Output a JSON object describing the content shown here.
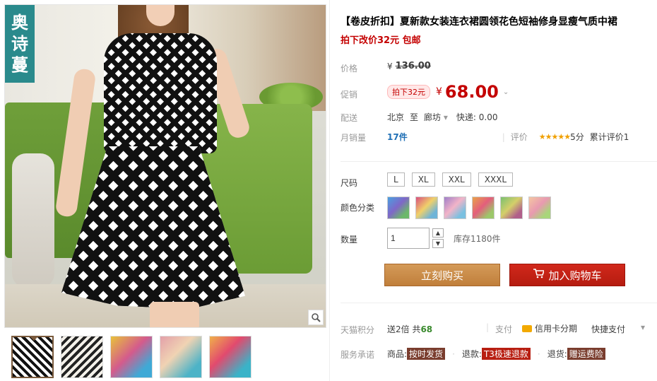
{
  "product": {
    "title": "【卷皮折扣】夏新款女装连衣裙圆领花色短袖修身显瘦气质中裙",
    "subtitle": "拍下改价32元 包邮",
    "brand_logo": [
      "奥",
      "诗",
      "蔓"
    ]
  },
  "price": {
    "label": "价格",
    "currency": "¥",
    "original": "136.00",
    "promo_label": "促销",
    "promo_tag": "拍下32元",
    "promo_price": "68.00"
  },
  "shipping": {
    "label": "配送",
    "from": "北京",
    "to_word": "至",
    "to": "廊坊",
    "express": "快递: 0.00"
  },
  "sales": {
    "label": "月销量",
    "count": "17件",
    "rating_label": "评价",
    "stars": "★★★★★",
    "score": "5分",
    "review_count": "累计评价1"
  },
  "options": {
    "size_label": "尺码",
    "sizes": [
      "L",
      "XL",
      "XXL",
      "XXXL"
    ],
    "color_label": "颜色分类",
    "color_count": 6,
    "qty_label": "数量",
    "qty_value": "1",
    "stock": "库存1180件"
  },
  "actions": {
    "buy": "立刻购买",
    "cart": "加入购物车"
  },
  "points": {
    "label": "天猫积分",
    "prefix": "送2倍 共",
    "value": "68",
    "pay_label": "支付",
    "credit": "信用卡分期",
    "quick": "快捷支付"
  },
  "service": {
    "label": "服务承诺",
    "goods_label": "商品:",
    "goods_value": "按时发货",
    "refund_label": "退款:",
    "refund_value": "T3极速退款",
    "return_label": "退货:",
    "return_value": "赠运费险"
  },
  "colors": {
    "accent_red": "#c40000",
    "buy_button": "#c98b48",
    "cart_button": "#c2211a",
    "brand_teal": "#2a8a8c"
  }
}
